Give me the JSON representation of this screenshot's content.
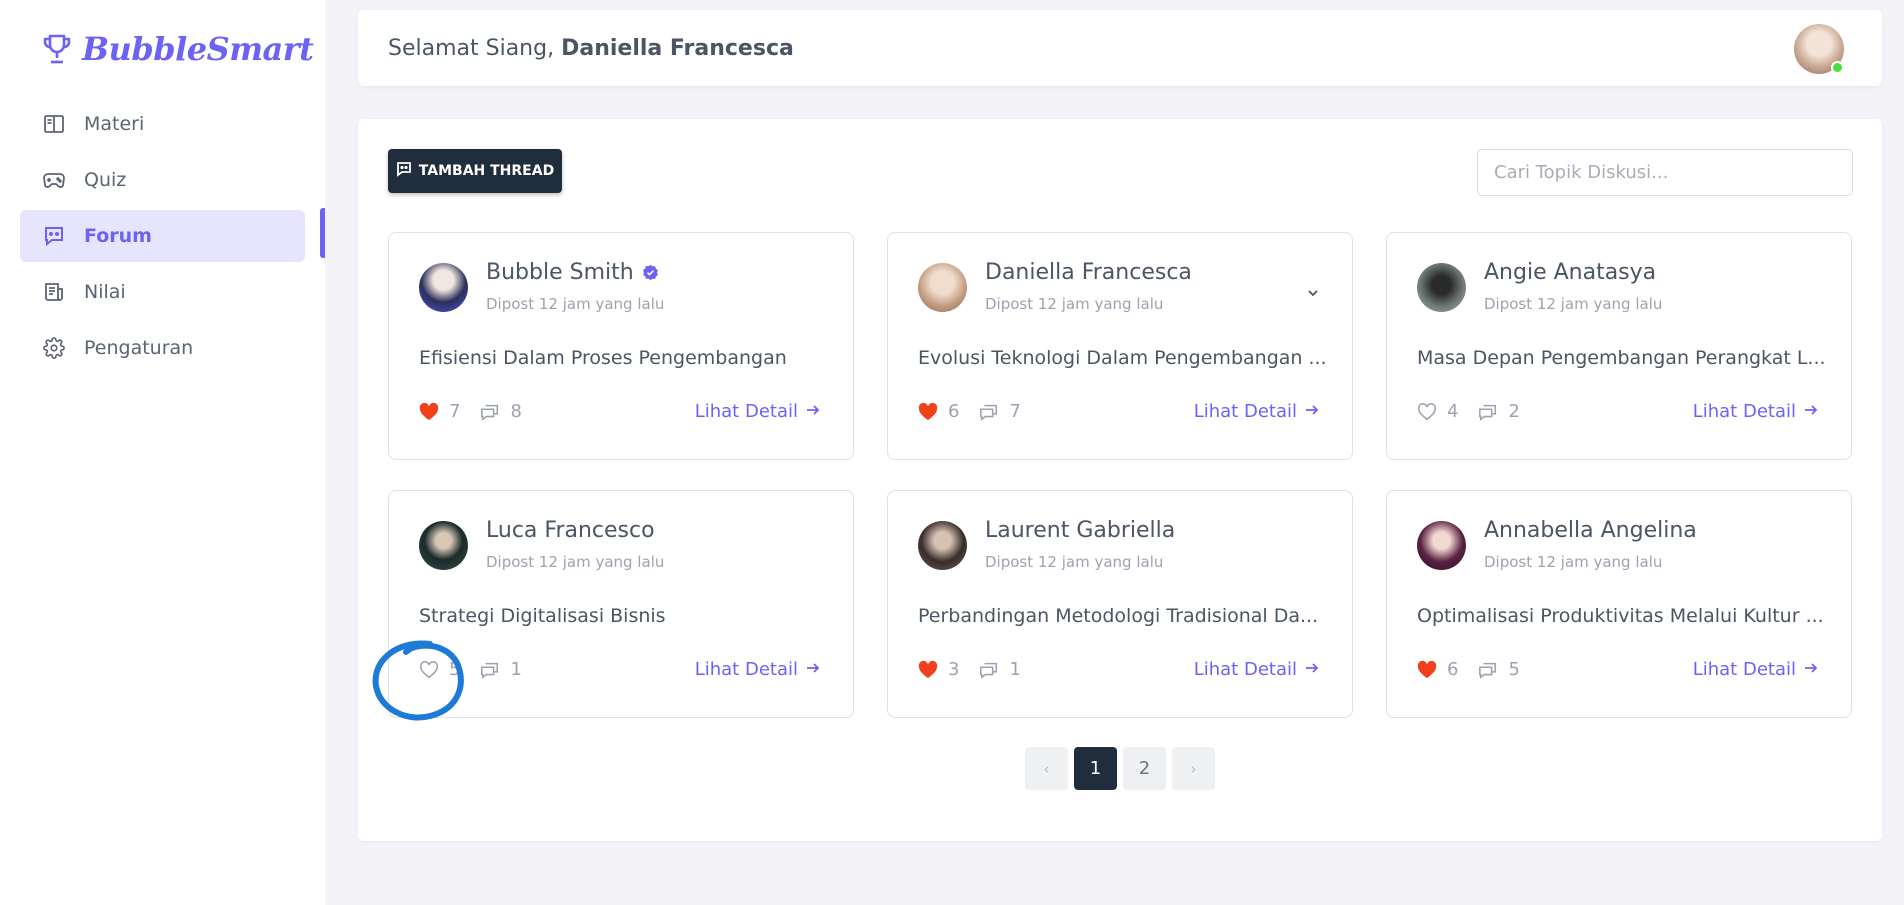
{
  "brand": {
    "name": "BubbleSmart",
    "icon": "trophy-icon",
    "color": "#6c63f5"
  },
  "sidebar": {
    "items": [
      {
        "label": "Materi",
        "icon": "book-open-icon",
        "active": false
      },
      {
        "label": "Quiz",
        "icon": "gamepad-icon",
        "active": false
      },
      {
        "label": "Forum",
        "icon": "chat-icon",
        "active": true
      },
      {
        "label": "Nilai",
        "icon": "report-icon",
        "active": false
      },
      {
        "label": "Pengaturan",
        "icon": "gear-icon",
        "active": false
      }
    ]
  },
  "header": {
    "greeting": "Selamat Siang,",
    "user_name": "Daniella Francesca",
    "online": true
  },
  "toolbar": {
    "add_thread_label": "TAMBAH THREAD",
    "search_placeholder": "Cari Topik Diskusi..."
  },
  "threads": [
    {
      "author": "Bubble Smith",
      "verified": true,
      "posted": "Dipost 12 jam yang lalu",
      "title": "Efisiensi Dalam Proses Pengembangan",
      "likes": "7",
      "liked": true,
      "comments": "8",
      "detail_label": "Lihat Detail",
      "has_menu": false
    },
    {
      "author": "Daniella Francesca",
      "verified": false,
      "posted": "Dipost 12 jam yang lalu",
      "title": "Evolusi Teknologi Dalam Pengembangan ...",
      "likes": "6",
      "liked": true,
      "comments": "7",
      "detail_label": "Lihat Detail",
      "has_menu": true
    },
    {
      "author": "Angie Anatasya",
      "verified": false,
      "posted": "Dipost 12 jam yang lalu",
      "title": "Masa Depan Pengembangan Perangkat L...",
      "likes": "4",
      "liked": false,
      "comments": "2",
      "detail_label": "Lihat Detail",
      "has_menu": false
    },
    {
      "author": "Luca Francesco",
      "verified": false,
      "posted": "Dipost 12 jam yang lalu",
      "title": "Strategi Digitalisasi Bisnis",
      "likes": "5",
      "liked": false,
      "comments": "1",
      "detail_label": "Lihat Detail",
      "has_menu": false
    },
    {
      "author": "Laurent Gabriella",
      "verified": false,
      "posted": "Dipost 12 jam yang lalu",
      "title": "Perbandingan Metodologi Tradisional Da...",
      "likes": "3",
      "liked": true,
      "comments": "1",
      "detail_label": "Lihat Detail",
      "has_menu": false
    },
    {
      "author": "Annabella Angelina",
      "verified": false,
      "posted": "Dipost 12 jam yang lalu",
      "title": "Optimalisasi Produktivitas Melalui Kultur ...",
      "likes": "6",
      "liked": true,
      "comments": "5",
      "detail_label": "Lihat Detail",
      "has_menu": false
    }
  ],
  "pagination": {
    "prev": "‹",
    "pages": [
      "1",
      "2"
    ],
    "current": "1",
    "next": "›"
  },
  "colors": {
    "accent": "#6c63f5",
    "liked": "#f0401c",
    "dark": "#1f2d3d",
    "annotation": "#1d7ad6"
  }
}
